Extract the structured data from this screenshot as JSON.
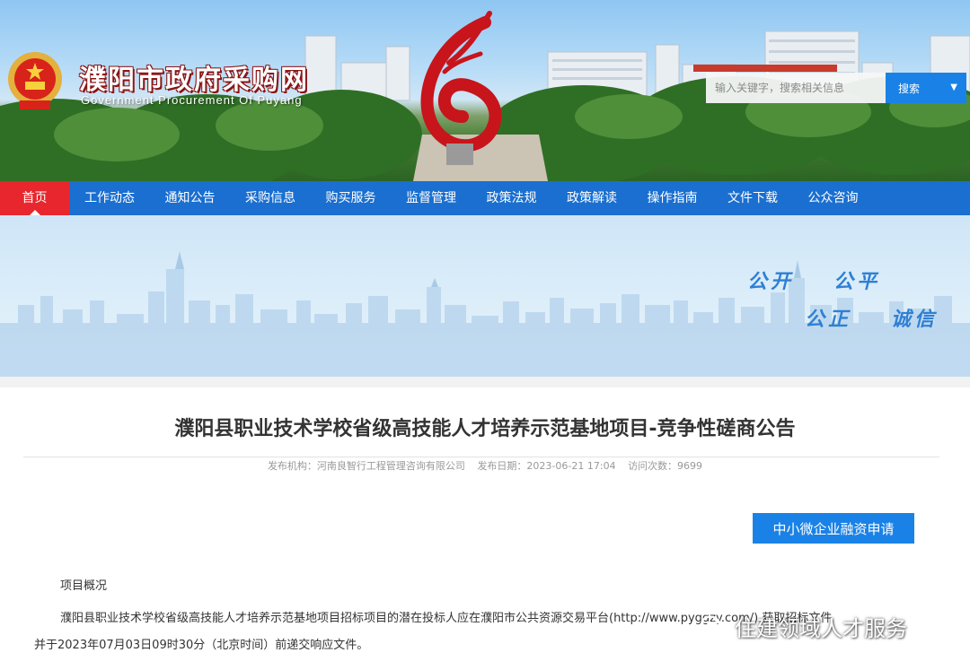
{
  "header": {
    "title": "濮阳市政府采购网",
    "subtitle": "Government Procurement Of Puyang",
    "emblem_icon": "national-emblem-icon",
    "search": {
      "placeholder": "输入关键字，搜索相关信息",
      "button_label": "搜索",
      "caret_glyph": "▼"
    }
  },
  "nav": {
    "items": [
      {
        "label": "首页",
        "active": true
      },
      {
        "label": "工作动态"
      },
      {
        "label": "通知公告"
      },
      {
        "label": "采购信息"
      },
      {
        "label": "购买服务"
      },
      {
        "label": "监督管理"
      },
      {
        "label": "政策法规"
      },
      {
        "label": "政策解读"
      },
      {
        "label": "操作指南"
      },
      {
        "label": "文件下载"
      },
      {
        "label": "公众咨询"
      }
    ]
  },
  "banner": {
    "slogans": [
      "公开",
      "公平",
      "公正",
      "诚信"
    ]
  },
  "article": {
    "title": "濮阳县职业技术学校省级高技能人才培养示范基地项目-竞争性磋商公告",
    "meta": {
      "publisher": "发布机构：河南良智行工程管理咨询有限公司",
      "date": "发布日期：2023-06-21 17:04",
      "visits": "访问次数：9699"
    },
    "finance_button": "中小微企业融资申请",
    "section_label": "项目概况",
    "paragraph_line1": "濮阳县职业技术学校省级高技能人才培养示范基地项目招标项目的潜在投标人应在濮阳市公共资源交易平台(http://www.pyggzy.com/)  获取招标文件",
    "paragraph_line2": "并于2023年07月03日09时30分（北京时间）前递交响应文件。"
  },
  "watermark": {
    "text": "住建领域人才服务",
    "icon": "wechat-icon"
  },
  "colors": {
    "nav_bg": "#1a6fd0",
    "nav_active": "#e8262d",
    "accent_blue": "#1a82e6",
    "slogan_blue": "#2f7fd4"
  }
}
